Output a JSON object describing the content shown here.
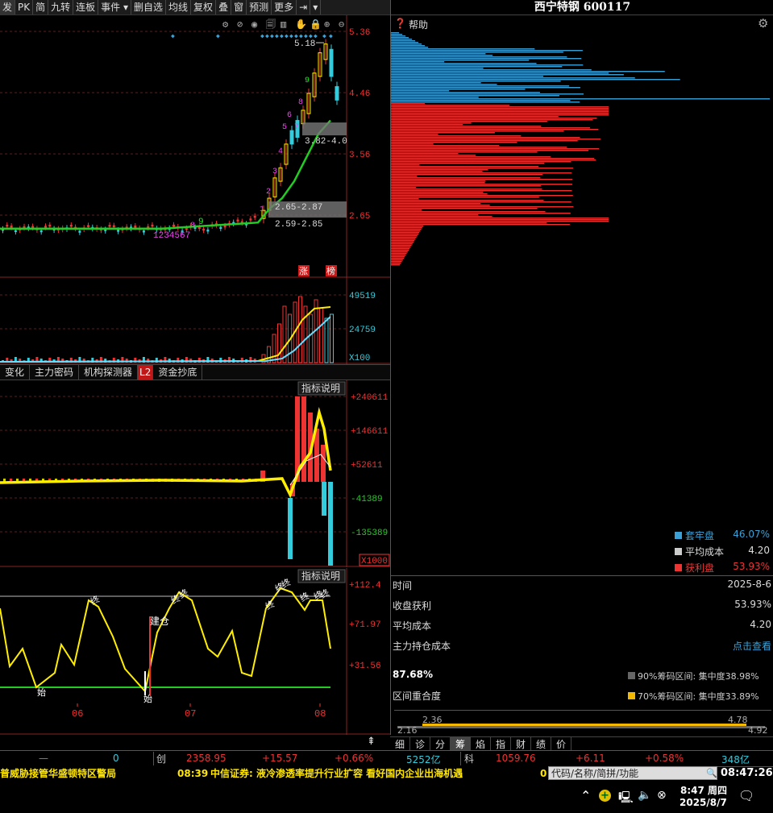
{
  "toolbar": [
    "发",
    "PK",
    "简",
    "九转",
    "连板",
    "事件 ▾",
    "删自选",
    "均线",
    "复权",
    "叠",
    "窗",
    "预测",
    "更多",
    "⇥",
    "▾"
  ],
  "stock": {
    "name_code": "西宁特钢 600117",
    "help": "帮助"
  },
  "price_axis": [
    "5.36",
    "4.46",
    "3.56",
    "2.65"
  ],
  "chart_annotations": {
    "high": "5.18",
    "range1": "3.82-4.0",
    "range2": "2.65-2.87",
    "range3": "2.59-2.85",
    "seq_small": "1234567",
    "seq_8": "8",
    "seq_9": "9",
    "seq_big": [
      "1",
      "2",
      "3",
      "4",
      "5",
      "6",
      "7",
      "8",
      "9"
    ],
    "badge_zhang": "涨",
    "badge_bang": "榜"
  },
  "volume": {
    "max": "49519",
    "mid": "24759",
    "unit": "X100"
  },
  "subtabs": [
    "变化",
    "主力密码",
    "机构探测器",
    "L2",
    "资金抄底"
  ],
  "ind1": {
    "explain": "指标说明",
    "axis": [
      "+240611",
      "+146611",
      "+52611",
      "-41389",
      "-135389"
    ],
    "unit": "X1000"
  },
  "ind2": {
    "explain": "指标说明",
    "axis": [
      "+112.4",
      "+71.97",
      "+31.56"
    ],
    "labels": {
      "di1": "始",
      "di2": "始",
      "jiancang": "建仓",
      "zhong": "终"
    }
  },
  "months": [
    "06",
    "07",
    "08"
  ],
  "legend": [
    {
      "label": "套牢盘",
      "value": "46.07%",
      "color": "#3aa0d6"
    },
    {
      "label": "平均成本",
      "value": "4.20",
      "color": "#cccccc"
    },
    {
      "label": "获利盘",
      "value": "53.93%",
      "color": "#ee3333"
    }
  ],
  "info": [
    {
      "label": "时间",
      "value": "2025-8-6"
    },
    {
      "label": "收盘获利",
      "value": "53.93%"
    },
    {
      "label": "平均成本",
      "value": "4.20"
    },
    {
      "label": "主力持仓成本",
      "value": "点击查看"
    }
  ],
  "overlap": {
    "pct": "87.68%",
    "label": "区间重合度",
    "r90": "90%筹码区间: 集中度38.98%",
    "r70": "70%筹码区间: 集中度33.89%"
  },
  "range_bar": {
    "a": "2.36",
    "b": "4.78",
    "c": "2.16",
    "d": "4.92"
  },
  "bottomtabs": [
    "细",
    "诊",
    "分",
    "筹",
    "焰",
    "指",
    "财",
    "绩",
    "价"
  ],
  "indexbar": {
    "dash": "—",
    "zero": "0",
    "chuang": "创",
    "c_val": "2358.95",
    "c_chg": "+15.57",
    "c_pct": "+0.66%",
    "c_amt": "5252亿",
    "ke": "科",
    "k_val": "1059.76",
    "k_chg": "+6.11",
    "k_pct": "+0.58%",
    "k_amt": "348亿"
  },
  "ticker": {
    "left": "普威胁接管华盛顿特区警局",
    "time": "08:39",
    "text": "中信证券: 液冷渗透率提升行业扩容 看好国内企业出海机遇",
    "zero": "0"
  },
  "search": "代码/名称/简拼/功能",
  "clock": "08:47:26",
  "taskbar": {
    "time": "8:47 周四",
    "date": "2025/8/7"
  },
  "colors": {
    "up": "#ee3333",
    "down": "#33ccdd",
    "ma": "#22cc22",
    "yellow": "#ffee00",
    "blue": "#3aa0d6"
  }
}
